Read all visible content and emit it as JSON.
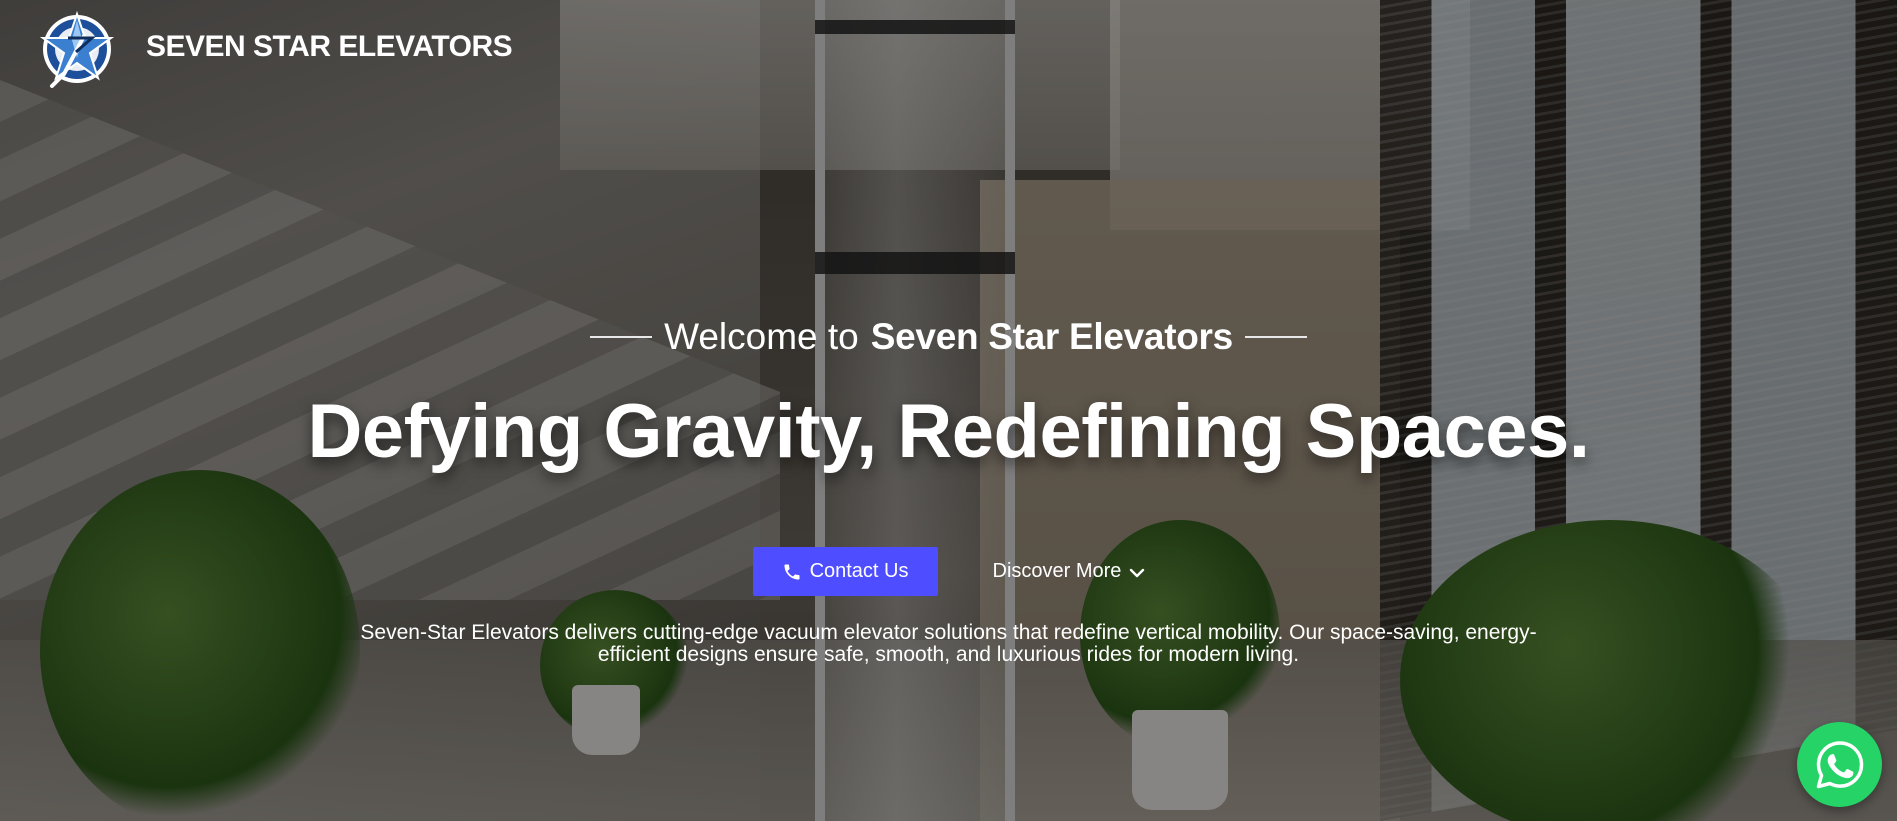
{
  "header": {
    "brand_name": "SEVEN STAR ELEVATORS",
    "logo_icon": "star-logo-icon"
  },
  "hero": {
    "welcome_prefix": "Welcome to",
    "welcome_brand": "Seven Star Elevators",
    "headline": "Defying Gravity, Redefining Spaces.",
    "description": "Seven-Star Elevators delivers cutting-edge vacuum elevator solutions that redefine vertical mobility. Our space-saving, energy-efficient designs ensure safe, smooth, and luxurious rides for modern living."
  },
  "actions": {
    "contact_label": "Contact Us",
    "contact_icon": "phone-icon",
    "discover_label": "Discover More",
    "discover_icon": "chevron-down-icon"
  },
  "floating": {
    "whatsapp_icon": "whatsapp-icon"
  },
  "colors": {
    "accent": "#4e4dff",
    "whatsapp": "#25d366",
    "text": "#ffffff"
  }
}
